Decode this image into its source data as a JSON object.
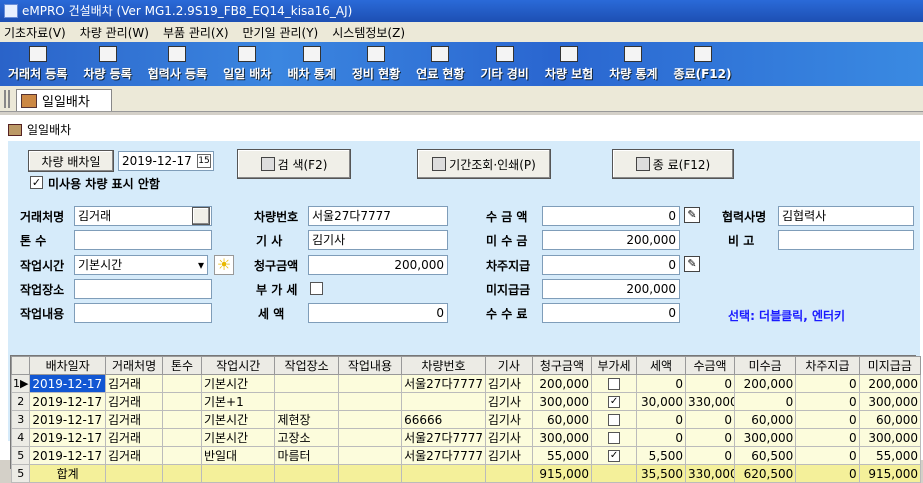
{
  "window": {
    "title": "eMPRO 건설배차 (Ver MG1.2.9S19_FB8_EQ14_kisa16_AJ)"
  },
  "menu": [
    "기초자료(V)",
    "차량 관리(W)",
    "부품 관리(X)",
    "만기일 관리(Y)",
    "시스템정보(Z)"
  ],
  "toolbar": [
    "거래처 등록",
    "차량 등록",
    "협력사 등록",
    "일일 배차",
    "배차 통계",
    "정비 현황",
    "연료 현황",
    "기타 경비",
    "차량 보험",
    "차량 통계",
    "종료(F12)"
  ],
  "tab": {
    "label": "일일배차"
  },
  "panel": {
    "title": "일일배차"
  },
  "top": {
    "date_button": "차량 배차일",
    "date_value": "2019-12-17",
    "date_spin": "15",
    "unused_label": "미사용 차량 표시 안함",
    "unused_checked": "✓",
    "search": "검 색(F2)",
    "period": "기간조회·인쇄(P)",
    "exit": "종  료(F12)"
  },
  "fields": {
    "client_label": "거래처명",
    "client": "김거래",
    "tons_label": "톤   수",
    "tons": "",
    "worktime_label": "작업시간",
    "worktime": "기본시간",
    "workplace_label": "작업장소",
    "workplace": "",
    "workdesc_label": "작업내용",
    "workdesc": "",
    "carno_label": "차량번호",
    "carno": "서울27다7777",
    "driver_label": "기   사",
    "driver": "김기사",
    "billed_label": "청구금액",
    "billed": "200,000",
    "vat_label": "부 가 세",
    "vat_checked": "",
    "tax_label": "세   액",
    "tax": "0",
    "received_label": "수 금 액",
    "received": "0",
    "unreceived_label": "미 수 금",
    "unreceived": "200,000",
    "carpay_label": "차주지급",
    "carpay": "0",
    "unpaid_label": "미지급금",
    "unpaid": "200,000",
    "fee_label": "수 수 료",
    "fee": "0",
    "partner_label": "협력사명",
    "partner": "김협력사",
    "memo_label": "비   고",
    "memo": "",
    "hint": "선택: 더블클릭, 엔터키"
  },
  "grid": {
    "headers": [
      "배차일자",
      "거래처명",
      "톤수",
      "작업시간",
      "작업장소",
      "작업내용",
      "차량번호",
      "기사",
      "청구금액",
      "부가세",
      "세액",
      "수금액",
      "미수금",
      "차주지급",
      "미지급금"
    ],
    "rows": [
      {
        "no": "1",
        "date": "2019-12-17",
        "client": "김거래",
        "tons": "",
        "time": "기본시간",
        "place": "",
        "desc": "",
        "car": "서울27다7777",
        "driver": "김기사",
        "billed": "200,000",
        "vat": "",
        "tax": "0",
        "recv": "0",
        "unrecv": "200,000",
        "carpay": "0",
        "unpaid": "200,000"
      },
      {
        "no": "2",
        "date": "2019-12-17",
        "client": "김거래",
        "tons": "",
        "time": "기본+1",
        "place": "",
        "desc": "",
        "car": "",
        "driver": "김기사",
        "billed": "300,000",
        "vat": "✓",
        "tax": "30,000",
        "recv": "330,000",
        "unrecv": "0",
        "carpay": "0",
        "unpaid": "300,000"
      },
      {
        "no": "3",
        "date": "2019-12-17",
        "client": "김거래",
        "tons": "",
        "time": "기본시간",
        "place": "제현장",
        "desc": "",
        "car": "66666",
        "driver": "김기사",
        "billed": "60,000",
        "vat": "",
        "tax": "0",
        "recv": "0",
        "unrecv": "60,000",
        "carpay": "0",
        "unpaid": "60,000"
      },
      {
        "no": "4",
        "date": "2019-12-17",
        "client": "김거래",
        "tons": "",
        "time": "기본시간",
        "place": "고장소",
        "desc": "",
        "car": "서울27다7777",
        "driver": "김기사",
        "billed": "300,000",
        "vat": "",
        "tax": "0",
        "recv": "0",
        "unrecv": "300,000",
        "carpay": "0",
        "unpaid": "300,000"
      },
      {
        "no": "5",
        "date": "2019-12-17",
        "client": "김거래",
        "tons": "",
        "time": "반일대",
        "place": "마름터",
        "desc": "",
        "car": "서울27다7777",
        "driver": "김기사",
        "billed": "55,000",
        "vat": "✓",
        "tax": "5,500",
        "recv": "0",
        "unrecv": "60,500",
        "carpay": "0",
        "unpaid": "55,000"
      }
    ],
    "total": {
      "no": "5",
      "label": "합계",
      "billed": "915,000",
      "tax": "35,500",
      "recv": "330,000",
      "unrecv": "620,500",
      "carpay": "0",
      "unpaid": "915,000"
    }
  }
}
